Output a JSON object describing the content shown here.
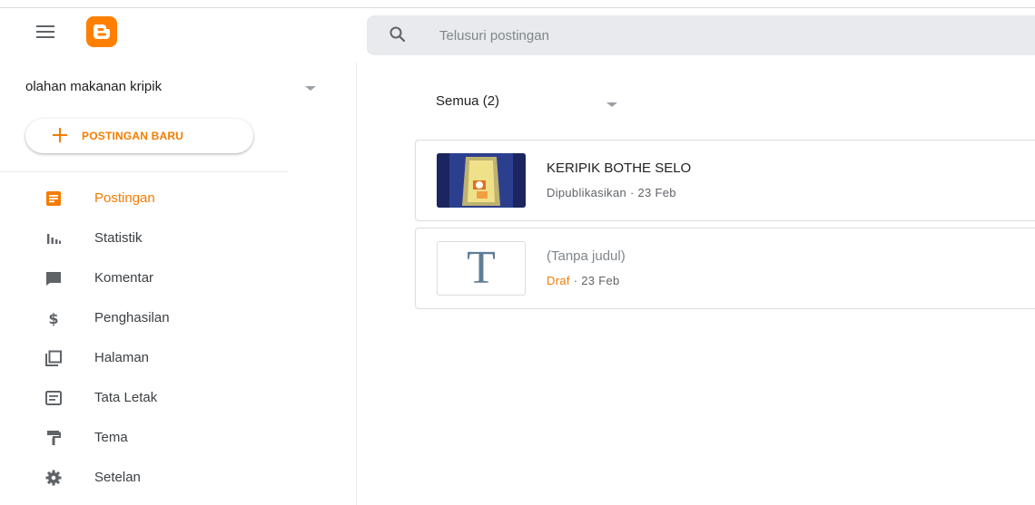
{
  "header": {
    "menu_icon": "hamburger-menu-icon",
    "logo_icon": "blogger-logo-icon",
    "search": {
      "placeholder": "Telusuri postingan",
      "value": "",
      "icon": "search-icon"
    }
  },
  "sidebar": {
    "blog_name": "olahan makanan kripik",
    "new_post_label": "POSTINGAN BARU",
    "items": [
      {
        "label": "Postingan",
        "icon": "posts-icon",
        "active": true
      },
      {
        "label": "Statistik",
        "icon": "stats-icon"
      },
      {
        "label": "Komentar",
        "icon": "comment-icon"
      },
      {
        "label": "Penghasilan",
        "icon": "dollar-icon"
      },
      {
        "label": "Halaman",
        "icon": "pages-icon"
      },
      {
        "label": "Tata Letak",
        "icon": "layout-icon"
      },
      {
        "label": "Tema",
        "icon": "theme-roller-icon"
      },
      {
        "label": "Setelan",
        "icon": "gear-icon"
      }
    ]
  },
  "main": {
    "filter_label": "Semua (2)",
    "posts": [
      {
        "title": "KERIPIK BOTHE SELO",
        "status": "Dipublikasikan",
        "separator": "·",
        "date": "23 Feb",
        "thumbnail": "product-photo"
      },
      {
        "title": "(Tanpa judul)",
        "status": "Draf",
        "separator": "·",
        "date": "23 Feb",
        "thumbnail": "text-T",
        "thumbnail_letter": "T"
      }
    ]
  },
  "colors": {
    "accent": "#f57c00",
    "logo": "#ff8000",
    "search_bg": "#e8eaed",
    "icon_dark": "#5f6368"
  }
}
